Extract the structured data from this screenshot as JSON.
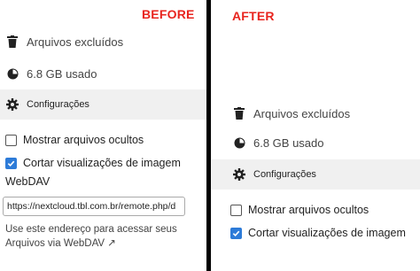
{
  "before": {
    "caption": "BEFORE",
    "deleted_files": "Arquivos excluídos",
    "quota": "6.8 GB usado",
    "settings": "Configurações",
    "show_hidden": "Mostrar arquivos ocultos",
    "crop_previews": "Cortar visualizações de imagem",
    "webdav_title": "WebDAV",
    "webdav_url": "https://nextcloud.tbl.com.br/remote.php/d",
    "webdav_help_line1": "Use este endereço para acessar seus",
    "webdav_help_line2": "Arquivos via WebDAV ↗"
  },
  "after": {
    "caption": "AFTER",
    "deleted_files": "Arquivos excluídos",
    "quota": "6.8 GB usado",
    "settings": "Configurações",
    "show_hidden": "Mostrar arquivos ocultos",
    "crop_previews": "Cortar visualizações de imagem"
  },
  "checkbox_states": {
    "show_hidden": false,
    "crop_previews": true
  },
  "colors": {
    "caption": "#e8251f",
    "checkbox": "#2d7bd8",
    "settings_bg": "#f0f0f0"
  },
  "icons": [
    "trash-icon",
    "pie-chart-icon",
    "gear-icon",
    "checkmark-icon"
  ]
}
